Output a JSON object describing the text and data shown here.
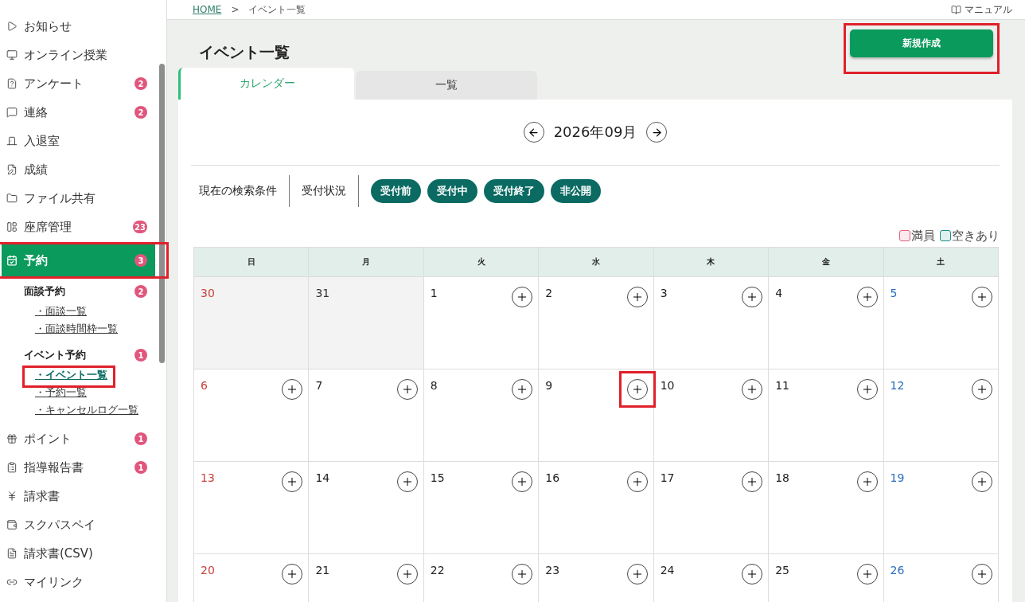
{
  "sidebar": {
    "items": [
      {
        "label": "お知らせ",
        "selected": false
      },
      {
        "label": "オンライン授業",
        "selected": false
      },
      {
        "label": "アンケート",
        "badge": "2",
        "selected": false
      },
      {
        "label": "連絡",
        "badge": "2",
        "selected": false
      },
      {
        "label": "入退室",
        "selected": false
      },
      {
        "label": "成績",
        "selected": false
      },
      {
        "label": "ファイル共有",
        "selected": false
      },
      {
        "label": "座席管理",
        "badge": "23",
        "selected": false
      },
      {
        "label": "予約",
        "badge": "3",
        "selected": true,
        "highlighted": true,
        "children": [
          {
            "label": "面談予約",
            "badge": "2",
            "children": [
              {
                "label": "・面談一覧",
                "selected": false
              },
              {
                "label": "・面談時間枠一覧",
                "selected": false
              }
            ]
          },
          {
            "label": "イベント予約",
            "badge": "1",
            "children": [
              {
                "label": "・イベント一覧",
                "selected": true,
                "highlighted": true
              },
              {
                "label": "・予約一覧",
                "selected": false
              },
              {
                "label": "・キャンセルログ一覧",
                "selected": false
              }
            ]
          }
        ]
      },
      {
        "label": "ポイント",
        "badge": "1",
        "selected": false
      },
      {
        "label": "指導報告書",
        "badge": "1",
        "selected": false
      },
      {
        "label": "請求書",
        "selected": false
      },
      {
        "label": "スクパスペイ",
        "selected": false
      },
      {
        "label": "請求書(CSV)",
        "selected": false
      },
      {
        "label": "マイリンク",
        "selected": false
      }
    ]
  },
  "breadcrumb": {
    "home": "HOME",
    "separator": ">",
    "current": "イベント一覧"
  },
  "manual_link": "マニュアル",
  "page_title": "イベント一覧",
  "new_button": {
    "label": "新規作成",
    "highlighted": true
  },
  "tabs": [
    {
      "label": "カレンダー",
      "selected": true
    },
    {
      "label": "一覧",
      "selected": false
    }
  ],
  "month": "2026年09月",
  "filters": {
    "label": "現在の検索条件",
    "group": "受付状況",
    "chips": [
      "受付前",
      "受付中",
      "受付終了",
      "非公開"
    ]
  },
  "legend": [
    {
      "label": "満員",
      "color": "#e0607f"
    },
    {
      "label": "空きあり",
      "color": "#1a8f83"
    }
  ],
  "calendar": {
    "weekdays": [
      "日",
      "月",
      "火",
      "水",
      "木",
      "金",
      "土"
    ],
    "weeks": [
      [
        {
          "day": "30",
          "outside": true
        },
        {
          "day": "31",
          "outside": true
        },
        {
          "day": "1",
          "outside": false
        },
        {
          "day": "2",
          "outside": false
        },
        {
          "day": "3",
          "outside": false
        },
        {
          "day": "4",
          "outside": false
        },
        {
          "day": "5",
          "outside": false
        }
      ],
      [
        {
          "day": "6",
          "outside": false
        },
        {
          "day": "7",
          "outside": false
        },
        {
          "day": "8",
          "outside": false
        },
        {
          "day": "9",
          "outside": false,
          "highlighted": true
        },
        {
          "day": "10",
          "outside": false
        },
        {
          "day": "11",
          "outside": false
        },
        {
          "day": "12",
          "outside": false
        }
      ],
      [
        {
          "day": "13",
          "outside": false
        },
        {
          "day": "14",
          "outside": false
        },
        {
          "day": "15",
          "outside": false
        },
        {
          "day": "16",
          "outside": false
        },
        {
          "day": "17",
          "outside": false
        },
        {
          "day": "18",
          "outside": false
        },
        {
          "day": "19",
          "outside": false
        }
      ],
      [
        {
          "day": "20",
          "outside": false
        },
        {
          "day": "21",
          "outside": false
        },
        {
          "day": "22",
          "outside": false
        },
        {
          "day": "23",
          "outside": false
        },
        {
          "day": "24",
          "outside": false
        },
        {
          "day": "25",
          "outside": false
        },
        {
          "day": "26",
          "outside": false
        }
      ]
    ]
  }
}
